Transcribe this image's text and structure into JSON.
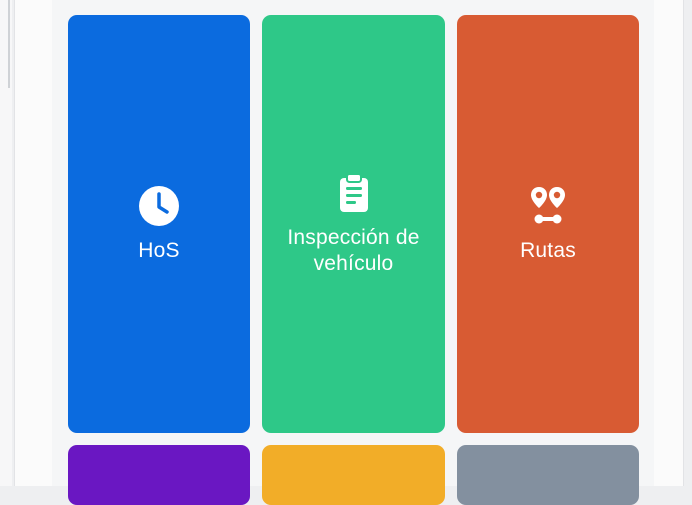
{
  "tiles": [
    {
      "id": "hos",
      "label": "HoS",
      "icon": "clock-icon",
      "color": "#0b6bdf"
    },
    {
      "id": "inspeccion",
      "label": "Inspección de vehículo",
      "icon": "clipboard-icon",
      "color": "#2ec888"
    },
    {
      "id": "rutas",
      "label": "Rutas",
      "icon": "route-icon",
      "color": "#d85b33"
    },
    {
      "id": "purple",
      "label": "",
      "icon": "",
      "color": "#6a17c2"
    },
    {
      "id": "yellow",
      "label": "",
      "icon": "",
      "color": "#f2ad28"
    },
    {
      "id": "gray",
      "label": "",
      "icon": "",
      "color": "#83909f"
    }
  ],
  "colors": {
    "background": "#eeeff1",
    "screen": "#f5f6f7"
  }
}
